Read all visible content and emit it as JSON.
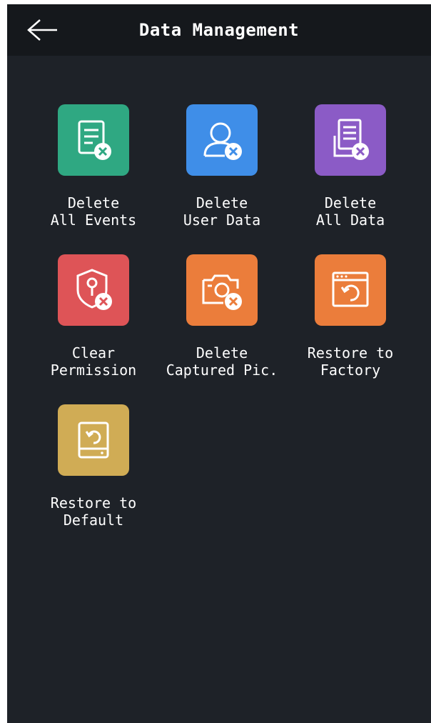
{
  "header": {
    "title": "Data Management",
    "back_icon": "arrow-left-icon"
  },
  "tiles": [
    {
      "label": "Delete\nAll Events",
      "icon": "delete-events-icon",
      "color": "#2fa882"
    },
    {
      "label": "Delete\nUser Data",
      "icon": "delete-user-icon",
      "color": "#3f8ee8"
    },
    {
      "label": "Delete\nAll Data",
      "icon": "delete-data-icon",
      "color": "#8b5bc6"
    },
    {
      "label": "Clear\nPermission",
      "icon": "clear-permission-icon",
      "color": "#de5457"
    },
    {
      "label": "Delete\nCaptured Pic.",
      "icon": "delete-picture-icon",
      "color": "#eb7d3b"
    },
    {
      "label": "Restore to\nFactory",
      "icon": "restore-factory-icon",
      "color": "#eb7d3b"
    },
    {
      "label": "Restore to\nDefault",
      "icon": "restore-default-icon",
      "color": "#d0ac55"
    }
  ]
}
